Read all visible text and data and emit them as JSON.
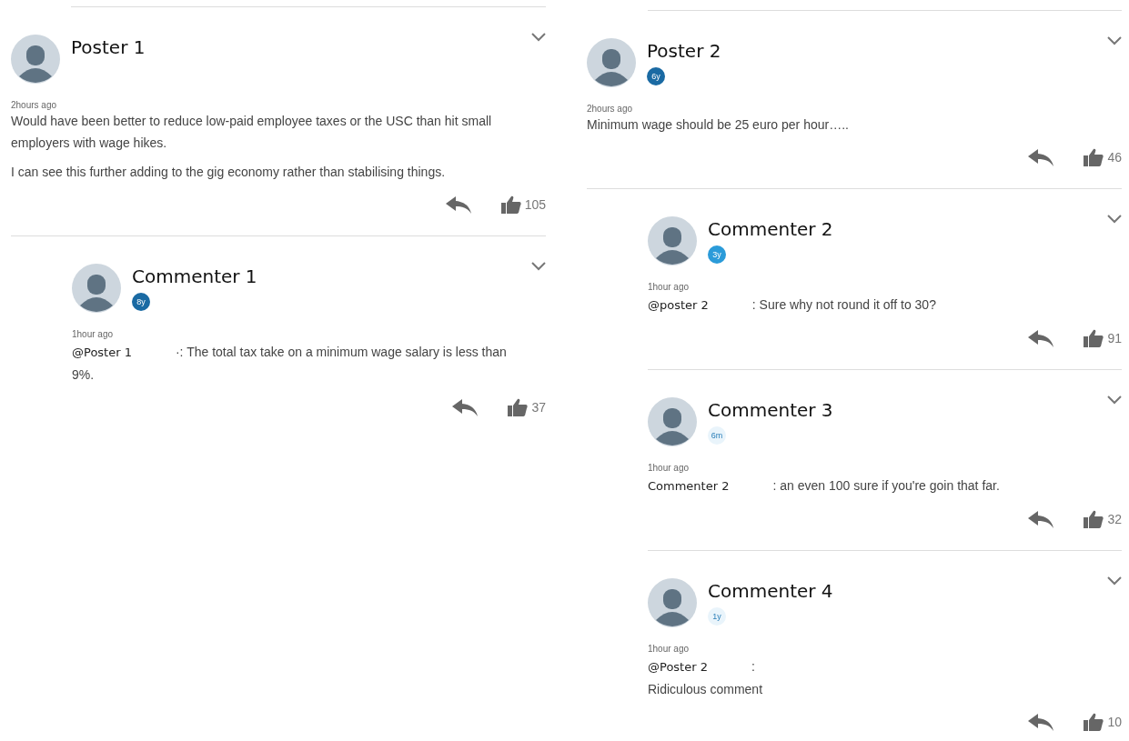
{
  "columns": [
    {
      "name": "Poster 1",
      "time": "2hours ago",
      "paragraphs": [
        "Would have been better to reduce low-paid employee taxes or the USC than hit small employers with wage hikes.",
        "I can see this further adding to the gig economy rather than stabilising things."
      ],
      "likes": "105",
      "replies": [
        {
          "name": "Commenter 1",
          "badge": {
            "text": "8y",
            "kind": "solid",
            "color": "#1a6aa3"
          },
          "time": "1hour ago",
          "mention": "@Poster 1",
          "lead": "·: The total tax take on a minimum wage salary is less than 9%.",
          "likes": "37"
        }
      ]
    },
    {
      "name": "Poster 2",
      "badge": {
        "text": "6y",
        "kind": "solid",
        "color": "#1a6aa3"
      },
      "time": "2hours ago",
      "paragraphs": [
        "Minimum wage should be 25 euro per hour….."
      ],
      "likes": "46",
      "replies": [
        {
          "name": "Commenter 2",
          "badge": {
            "text": "3y",
            "kind": "solid",
            "color": "#2b9bd9"
          },
          "time": "1hour ago",
          "mention": "@poster 2",
          "lead": ": Sure why not round it off to 30?",
          "likes": "91"
        },
        {
          "name": "Commenter 3",
          "badge": {
            "text": "6m",
            "kind": "pale",
            "color": "#e9f4fb"
          },
          "time": "1hour ago",
          "mention": "Commenter 2",
          "lead": ": an even 100 sure if you're goin that far.",
          "likes": "32"
        },
        {
          "name": "Commenter 4",
          "badge": {
            "text": "1y",
            "kind": "pale",
            "color": "#e9f4fb"
          },
          "time": "1hour ago",
          "mention": "@Poster 2",
          "lead": ":",
          "paragraphs": [
            "Ridiculous comment"
          ],
          "likes": "10"
        }
      ]
    }
  ]
}
